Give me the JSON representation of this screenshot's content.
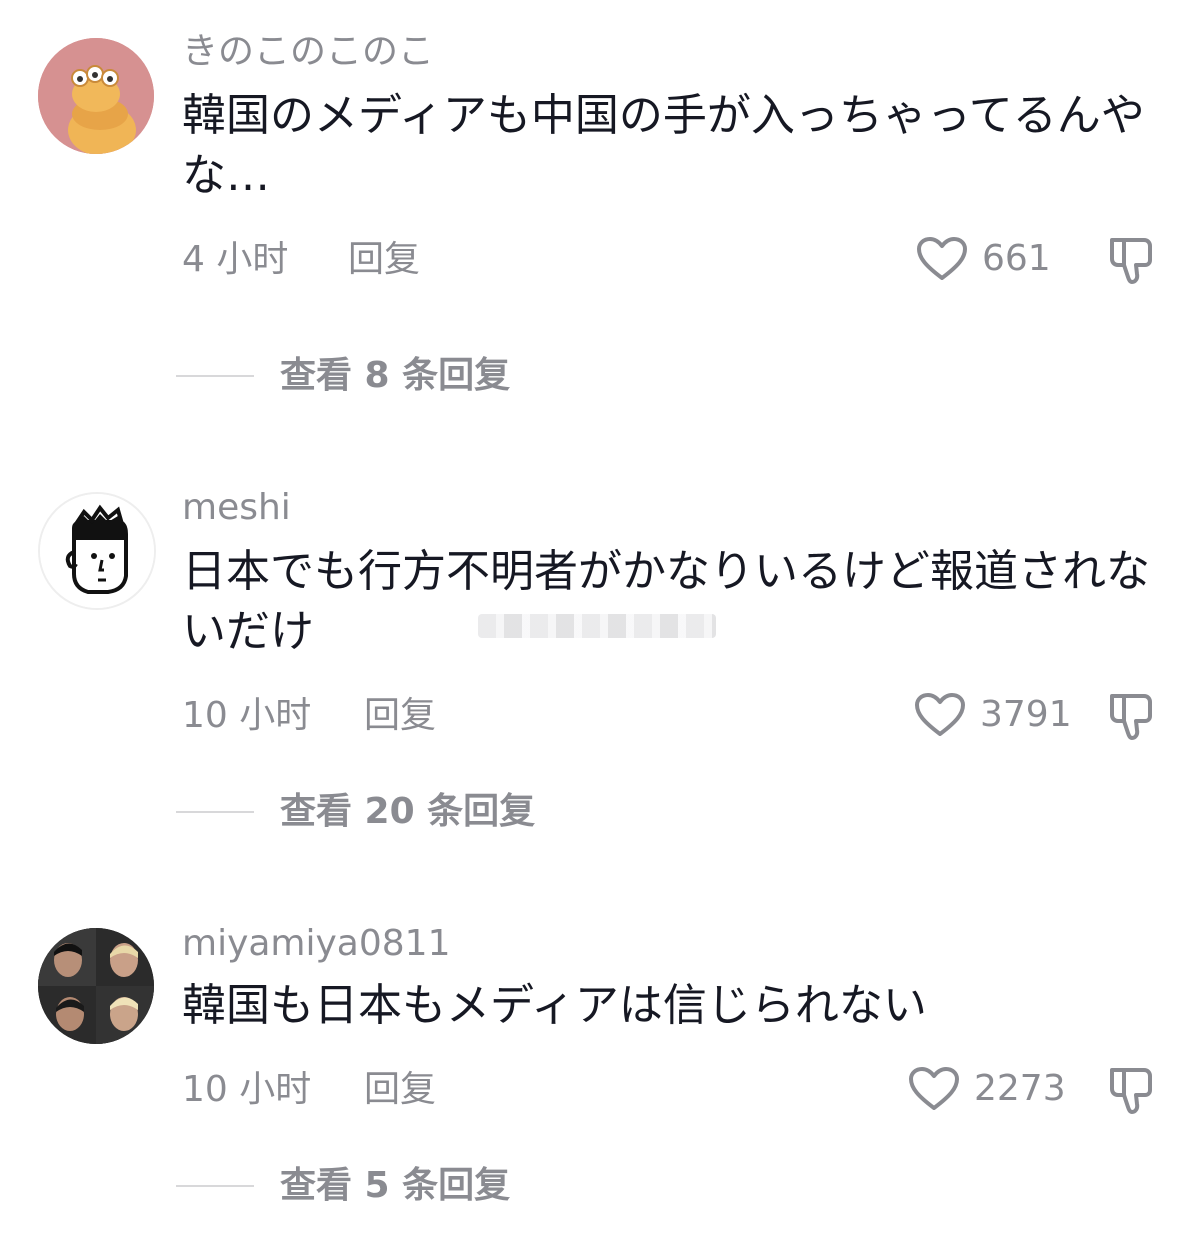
{
  "comments": [
    {
      "username": "きのこのこのこ",
      "text": "韓国のメディアも中国の手が入っちゃってるんやな…",
      "time": "4 小时",
      "reply_label": "回复",
      "likes": "661",
      "view_replies": "查看 8 条回复"
    },
    {
      "username": "meshi",
      "text": "日本でも行方不明者がかなりいるけど報道されないだけ",
      "time": "10 小时",
      "reply_label": "回复",
      "likes": "3791",
      "view_replies": "查看 20 条回复"
    },
    {
      "username": "miyamiya0811",
      "text": "韓国も日本もメディアは信じられない",
      "time": "10 小时",
      "reply_label": "回复",
      "likes": "2273",
      "view_replies": "查看 5 条回复"
    }
  ],
  "colors": {
    "secondary_text": "#8a8b91",
    "primary_text": "#161823"
  },
  "icons": [
    "heart-icon",
    "dislike-icon"
  ]
}
